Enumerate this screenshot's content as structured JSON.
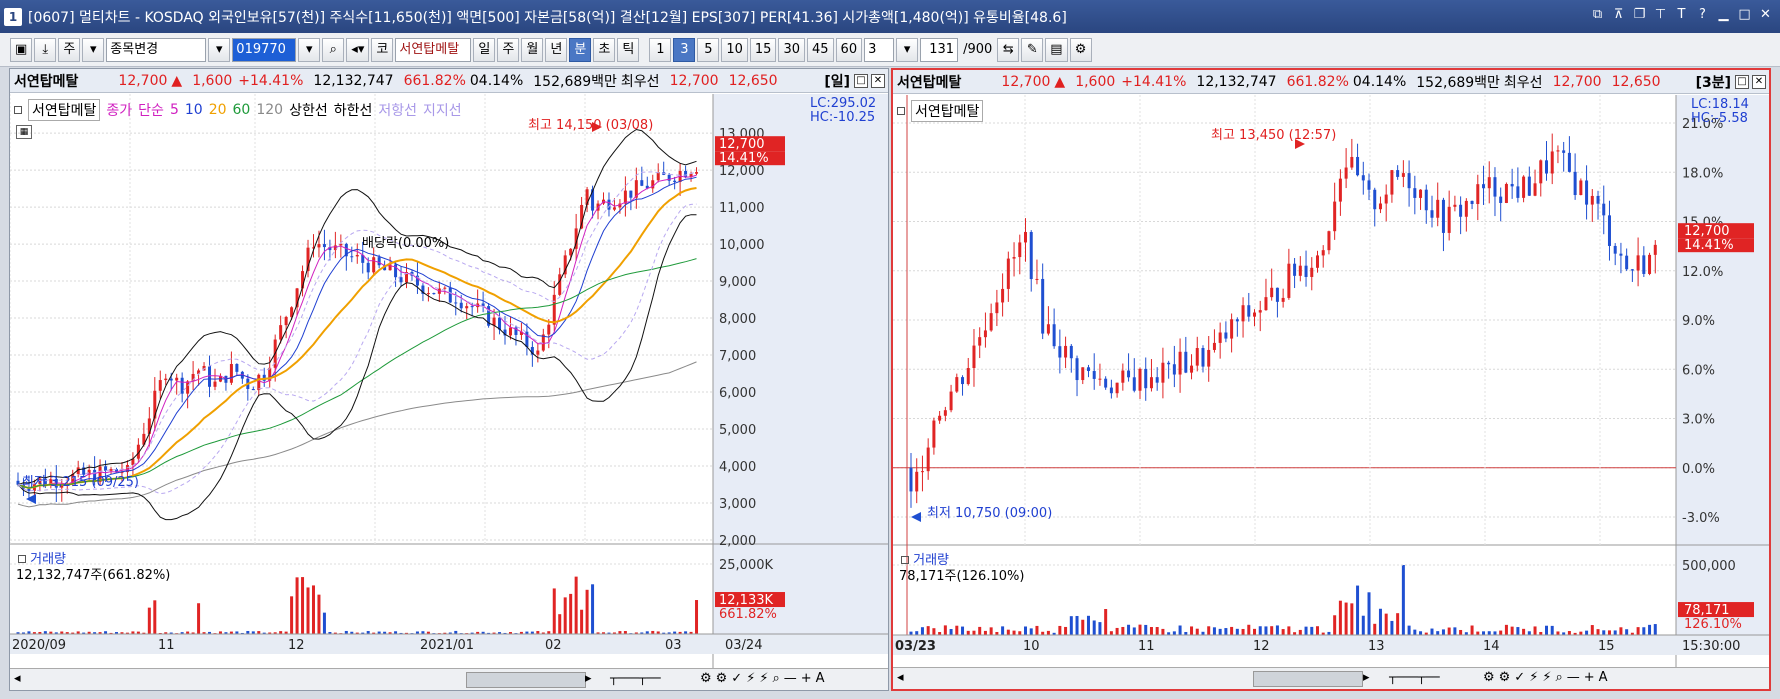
{
  "window": {
    "title": "[0607] 멀티차트 - KOSDAQ 외국인보유[57(천)] 주식수[11,650(천)] 액면[500] 자본금[58(억)] 결산[12월] EPS[307] PER[41.36] 시가총액[1,480(억)] 유통비율[48.6]",
    "app_badge": "1"
  },
  "toolbar": {
    "market": "주",
    "stock_change": "종목변경",
    "code": "019770",
    "code_type": "코",
    "stock_name": "서연탑메탈",
    "periods": [
      "일",
      "주",
      "월",
      "년",
      "분",
      "초",
      "틱"
    ],
    "selected_period": "분",
    "intervals": [
      "1",
      "3",
      "5",
      "10",
      "15",
      "30",
      "45",
      "60"
    ],
    "selected_interval": "3",
    "interval_value": "3",
    "count": "131",
    "count_total": "/900"
  },
  "left": {
    "name": "서연탑메탈",
    "price": "12,700",
    "change": "1,600",
    "pct": "+14.41%",
    "volume": "12,132,747",
    "vol_ratio": "661.82%",
    "rate": "04.14%",
    "amount": "152,689백만",
    "cond_label": "최우선",
    "bid": "12,700",
    "ask": "12,650",
    "period": "[일]",
    "legend": {
      "name": "서연탑메탈",
      "close": "종가",
      "ma_type": "단순",
      "ma": [
        "5",
        "10",
        "20",
        "60",
        "120"
      ],
      "upper": "상한선",
      "lower": "하한선",
      "resist": "저항선",
      "support": "지지선"
    },
    "lc": "LC:295.02",
    "hc": "HC:-10.25",
    "high_label": "최고 14,150 (03/08)",
    "low_label": "최저 3,215 (09/25)",
    "div_label": "배당락(0.00%)",
    "price_ticks": [
      "13,000",
      "12,000",
      "11,000",
      "10,000",
      "9,000",
      "8,000",
      "7,000",
      "6,000",
      "5,000",
      "4,000",
      "3,000",
      "2,000"
    ],
    "cur_price": "12,700",
    "cur_pct": "14.41%",
    "vol_title": "거래량",
    "vol_text": "12,132,747주(661.82%)",
    "vol_tick": "25,000K",
    "vol_cur": "12,133K",
    "vol_pct": "661.82%",
    "x_labels": [
      "2020/09",
      "11",
      "12",
      "2021/01",
      "02",
      "03"
    ],
    "x_right": "03/24"
  },
  "right": {
    "name": "서연탑메탈",
    "price": "12,700",
    "change": "1,600",
    "pct": "+14.41%",
    "volume": "12,132,747",
    "vol_ratio": "661.82%",
    "rate": "04.14%",
    "amount": "152,689백만",
    "cond_label": "최우선",
    "bid": "12,700",
    "ask": "12,650",
    "period": "[3분]",
    "legend": {
      "name": "서연탑메탈"
    },
    "lc": "LC:18.14",
    "hc": "HC:-5.58",
    "high_label": "최고 13,450 (12:57)",
    "low_label": "최저 10,750 (09:00)",
    "pct_ticks": [
      "21.0%",
      "18.0%",
      "15.0%",
      "12.0%",
      "9.0%",
      "6.0%",
      "3.0%",
      "0.0%",
      "-3.0%"
    ],
    "cur_price": "12,700",
    "cur_pct": "14.41%",
    "vol_title": "거래량",
    "vol_text": "78,171주(126.10%)",
    "vol_tick": "500,000",
    "vol_cur": "78,171",
    "vol_pct": "126.10%",
    "x_labels": [
      "03/23",
      "10",
      "11",
      "12",
      "13",
      "14",
      "15"
    ],
    "x_right": "15:30:00"
  },
  "colors": {
    "up": "#e02424",
    "down": "#1f4fd1",
    "titlebar": "#2a4680"
  }
}
